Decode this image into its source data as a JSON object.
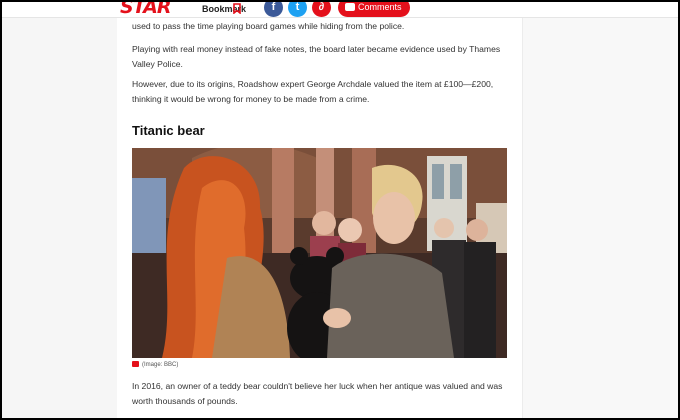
{
  "header": {
    "logo": "STAR",
    "bookmark_label": "Bookmark",
    "share": {
      "facebook_icon": "f",
      "twitter_icon": "t",
      "link_icon": "∂"
    },
    "comments_label": "Comments"
  },
  "article": {
    "p1": "used to pass the time playing board games while hiding from the police.",
    "p2": "Playing with real money instead of fake notes, the board later became evidence used by Thames Valley Police.",
    "p3": "However, due to its origins, Roadshow expert George Archdale valued the item at £100—£200, thinking it would be wrong for money to be made from a crime.",
    "heading": "Titanic bear",
    "image_caption": "(Image: BBC)",
    "p4": "In 2016, an owner of a teddy bear couldn't believe her luck when her antique was valued and was worth thousands of pounds."
  },
  "colors": {
    "brand": "#e4101b",
    "facebook": "#3b5998",
    "twitter": "#1da1f2"
  }
}
